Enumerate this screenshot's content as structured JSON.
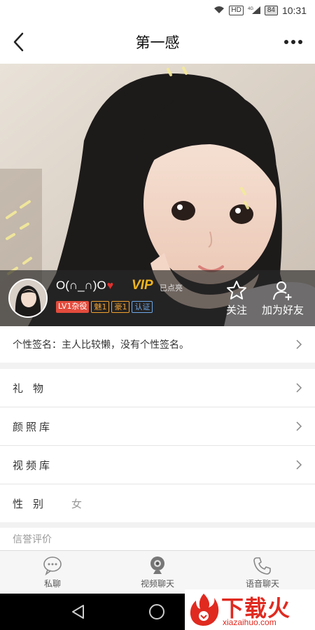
{
  "status_bar": {
    "time": "10:31",
    "hd_label": "HD",
    "network": "4G",
    "battery": "84"
  },
  "header": {
    "title": "第一感"
  },
  "profile": {
    "nickname": "O(∩_∩)O",
    "vip_label": "VIP",
    "lit_label": "已点亮",
    "badges": [
      "LV1杂役",
      "魅1",
      "豪1",
      "认证"
    ],
    "follow_label": "关注",
    "add_friend_label": "加为好友"
  },
  "signature": {
    "text": "个性签名：主人比较懒，没有个性签名。"
  },
  "rows": {
    "gift": "礼物",
    "photos": "颜照库",
    "videos": "视频库",
    "gender_label": "性别",
    "gender_value": "女"
  },
  "reputation": {
    "title": "信誉评价"
  },
  "tabs": {
    "private_chat": "私聊",
    "video_chat": "视频聊天",
    "voice_chat": "语音聊天"
  },
  "watermark": {
    "brand": "下载火",
    "domain": "xiazaihuo.com"
  },
  "colors": {
    "vip": "#f2b51c",
    "level_badge": "#e34b3c",
    "charm_badge": "#f0a030",
    "auth_badge": "#6ea7e8",
    "heart": "#e0312f"
  }
}
